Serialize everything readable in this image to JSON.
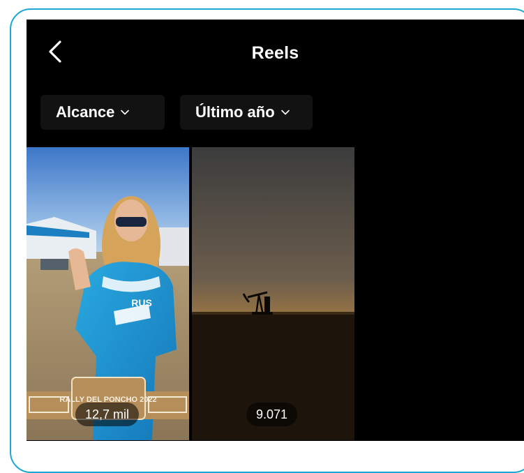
{
  "header": {
    "title": "Reels",
    "back_icon": "chevron-left-icon"
  },
  "filters": [
    {
      "label": "Alcance",
      "icon": "chevron-down-icon"
    },
    {
      "label": "Último año",
      "icon": "chevron-down-icon"
    }
  ],
  "reels": [
    {
      "views": "12,7 mil",
      "overlay_text": "RALLY DEL PONCHO 2022",
      "badge_text": "RUS"
    },
    {
      "views": "9.071"
    }
  ],
  "colors": {
    "frame_border": "#1da7d6",
    "background": "#000000",
    "text": "#ffffff"
  }
}
